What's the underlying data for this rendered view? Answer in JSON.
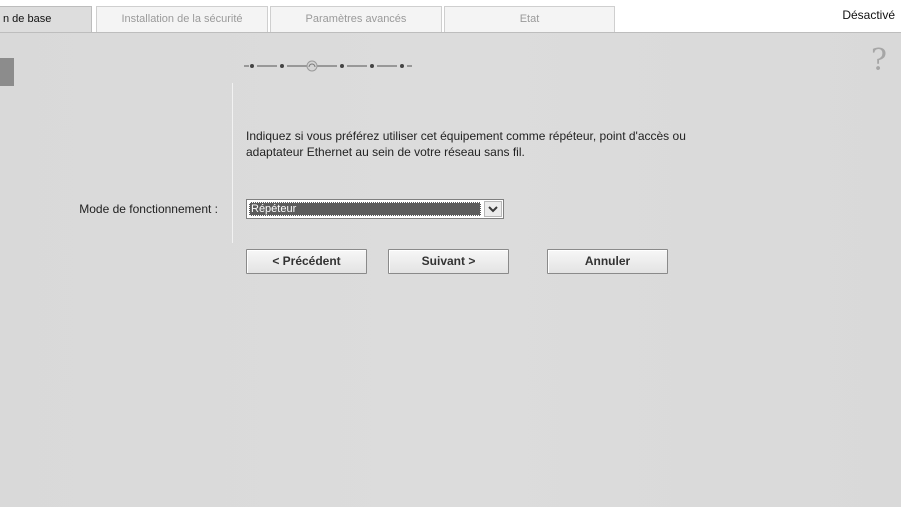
{
  "tabs": [
    {
      "label": "n de base",
      "active": true
    },
    {
      "label": "Installation de la sécurité",
      "active": false
    },
    {
      "label": "Paramètres avancés",
      "active": false
    },
    {
      "label": "Etat",
      "active": false
    }
  ],
  "status": "Désactivé",
  "help": {
    "label": "?"
  },
  "wizard": {
    "total_steps": 6,
    "current_step": 3
  },
  "description": "Indiquez si vous préférez utiliser cet équipement comme répéteur, point d'accès ou adaptateur Ethernet au sein de votre réseau sans fil.",
  "mode": {
    "label": "Mode de fonctionnement :",
    "selected": "Répéteur"
  },
  "buttons": {
    "previous": "< Précédent",
    "next": "Suivant >",
    "cancel": "Annuler"
  },
  "colors": {
    "panel_bg": "#dcdcdc",
    "select_highlight": "#5c5c5c"
  },
  "icons": {
    "help": "question-mark-icon",
    "dropdown": "chevron-down-icon"
  }
}
